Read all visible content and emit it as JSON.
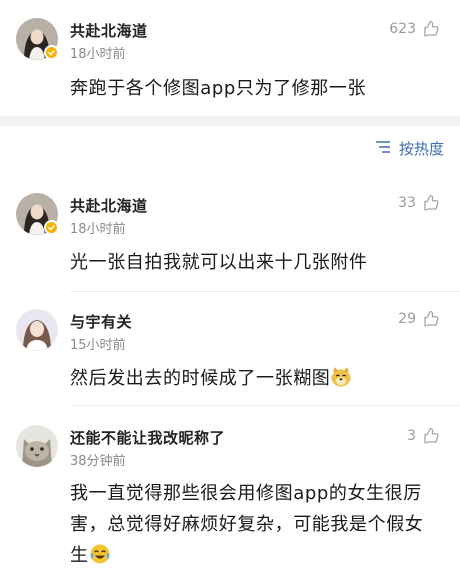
{
  "top_comment": {
    "user": "共赴北海道",
    "time": "18小时前",
    "likes": "623",
    "text": "奔跑于各个修图app只为了修那一张"
  },
  "sort": {
    "label": "按热度",
    "icon": "sort-lines-icon"
  },
  "comments": [
    {
      "user": "共赴北海道",
      "time": "18小时前",
      "likes": "33",
      "text": "光一张自拍我就可以出来十几张附件",
      "verified": true
    },
    {
      "user": "与宇有关",
      "time": "15小时前",
      "likes": "29",
      "text": "然后发出去的时候成了一张糊图",
      "emoji": "doge-emoji"
    },
    {
      "user": "还能不能让我改昵称了",
      "time": "38分钟前",
      "likes": "3",
      "text": "我一直觉得那些很会用修图app的女生很厉害，总觉得好麻烦好复杂，可能我是个假女生",
      "emoji": "laugh-cry-emoji"
    }
  ],
  "colors": {
    "link_blue": "#3d6fb0",
    "verified_gold": "#f5b400",
    "meta_gray": "#8a8a8a",
    "band_gray": "#f2f2f2"
  }
}
